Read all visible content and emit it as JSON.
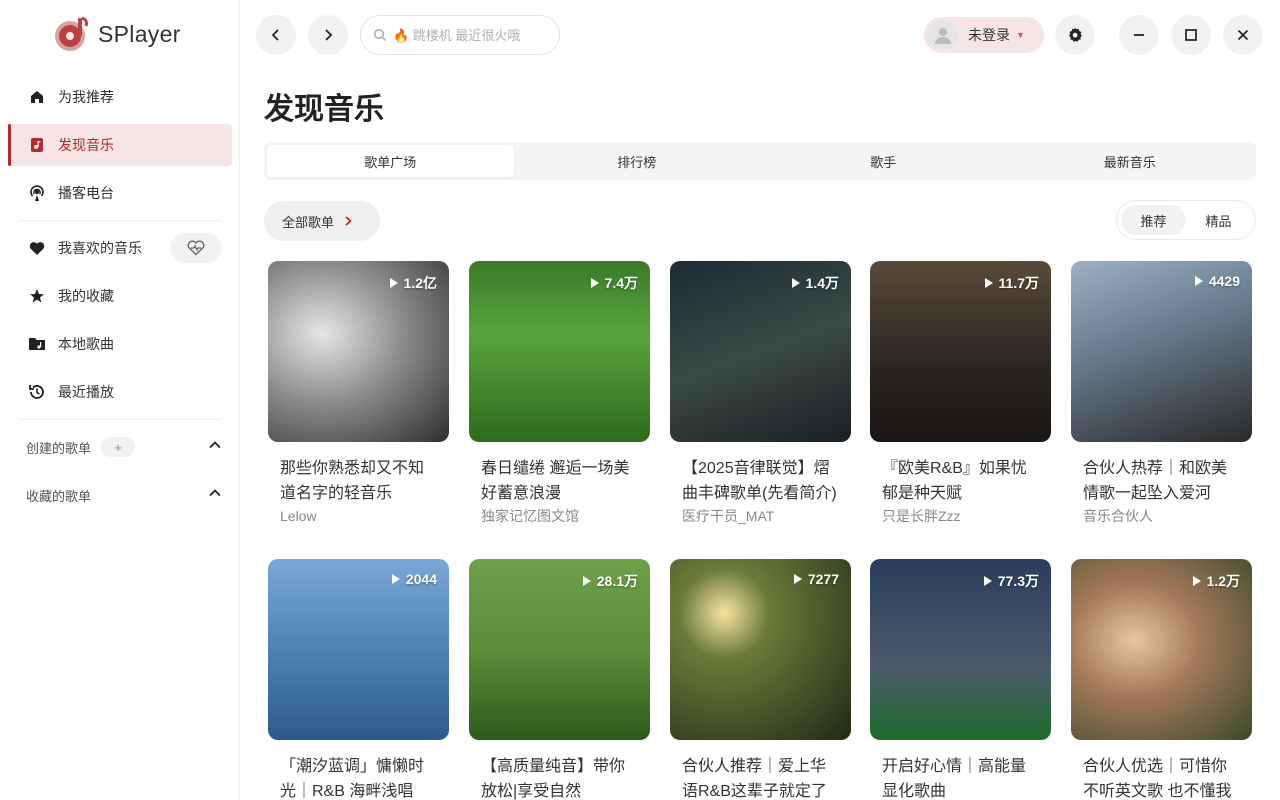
{
  "app": {
    "name": "SPlayer"
  },
  "sidebar": {
    "nav_top": [
      {
        "label": "为我推荐",
        "icon": "home-icon"
      },
      {
        "label": "发现音乐",
        "icon": "music-album-icon",
        "active": true
      },
      {
        "label": "播客电台",
        "icon": "podcast-icon"
      }
    ],
    "nav_library": [
      {
        "label": "我喜欢的音乐",
        "icon": "heart-icon"
      },
      {
        "label": "我的收藏",
        "icon": "star-icon"
      },
      {
        "label": "本地歌曲",
        "icon": "folder-music-icon"
      },
      {
        "label": "最近播放",
        "icon": "history-icon"
      }
    ],
    "created_playlists": {
      "label": "创建的歌单",
      "add_label": "+"
    },
    "collected_playlists": {
      "label": "收藏的歌单"
    }
  },
  "topbar": {
    "search_placeholder": "🔥 跳楼机 最近很火哦",
    "user_label": "未登录"
  },
  "page": {
    "title": "发现音乐",
    "tabs": [
      "歌单广场",
      "排行榜",
      "歌手",
      "最新音乐"
    ],
    "active_tab": 0,
    "category_button": "全部歌单",
    "filter_options": [
      "推荐",
      "精品"
    ],
    "active_filter": 0
  },
  "playlists": [
    {
      "title": "那些你熟悉却又不知道名字的轻音乐",
      "creator": "Lelow",
      "plays": "1.2亿"
    },
    {
      "title": "春日缱绻 邂逅一场美好蓄意浪漫",
      "creator": "独家记忆图文馆",
      "plays": "7.4万"
    },
    {
      "title": "【2025音律联觉】熠曲丰碑歌单(先看简介)",
      "creator": "医疗干员_MAT",
      "plays": "1.4万"
    },
    {
      "title": "『欧美R&B』如果忧郁是种天赋",
      "creator": "只是长胖Zzz",
      "plays": "11.7万"
    },
    {
      "title": "合伙人热荐｜和欧美情歌一起坠入爱河",
      "creator": "音乐合伙人",
      "plays": "4429"
    },
    {
      "title": "「潮汐蓝调」慵懒时光｜R&B 海畔浅唱",
      "creator": "",
      "plays": "2044"
    },
    {
      "title": "【高质量纯音】带你放松|享受自然",
      "creator": "",
      "plays": "28.1万"
    },
    {
      "title": "合伙人推荐｜爱上华语R&B这辈子就定了",
      "creator": "",
      "plays": "7277"
    },
    {
      "title": "开启好心情｜高能量显化歌曲",
      "creator": "",
      "plays": "77.3万"
    },
    {
      "title": "合伙人优选｜可惜你不听英文歌 也不懂我",
      "creator": "",
      "plays": "1.2万"
    }
  ]
}
